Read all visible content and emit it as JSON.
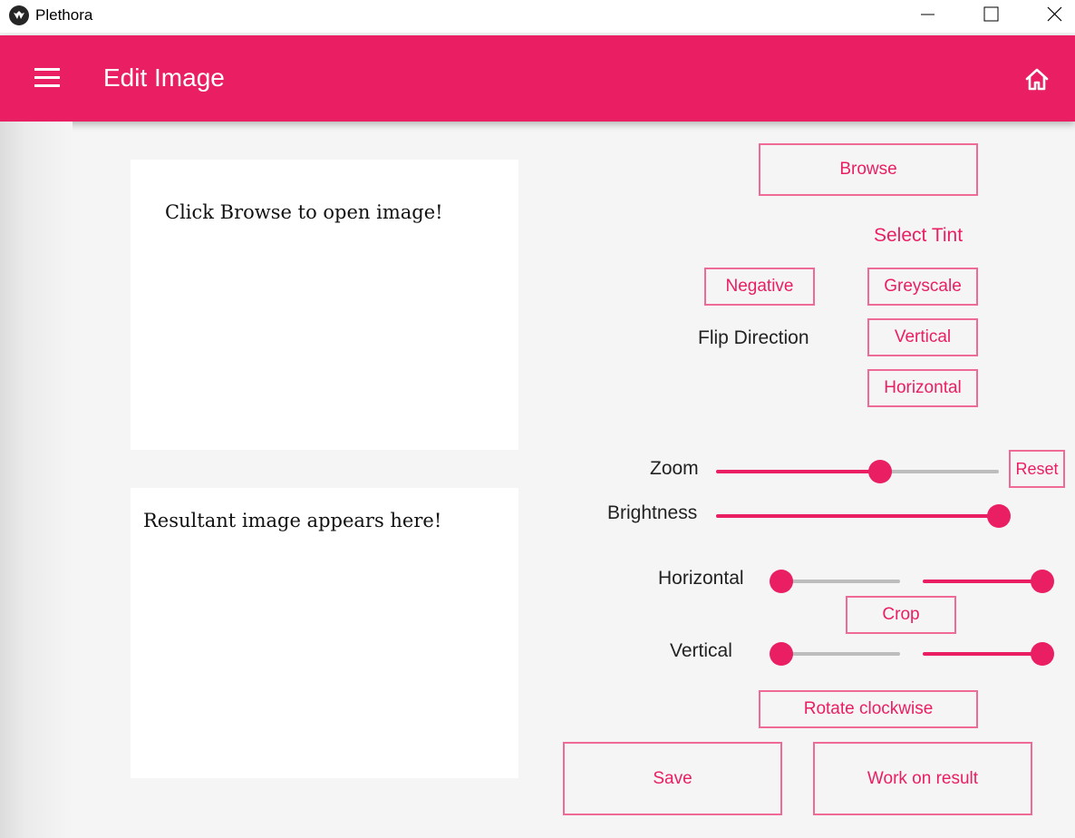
{
  "window": {
    "title": "Plethora"
  },
  "appbar": {
    "title": "Edit Image"
  },
  "panels": {
    "source_text": "Click Browse to open image!",
    "result_text": "Resultant image appears here!"
  },
  "controls": {
    "browse": "Browse",
    "select_tint": "Select Tint",
    "negative": "Negative",
    "greyscale": "Greyscale",
    "flip_direction": "Flip Direction",
    "vertical": "Vertical",
    "horizontal": "Horizontal",
    "zoom": "Zoom",
    "reset": "Reset",
    "brightness": "Brightness",
    "crop_horizontal": "Horizontal",
    "crop": "Crop",
    "crop_vertical": "Vertical",
    "rotate": "Rotate clockwise",
    "save": "Save",
    "work_on_result": "Work on result"
  },
  "sliders": {
    "zoom": 0.58,
    "brightness": 1.0,
    "crop_horizontal": [
      0.0,
      1.0
    ],
    "crop_vertical": [
      0.0,
      1.0
    ]
  },
  "colors": {
    "accent": "#e91e63",
    "button_border": "#ef6a94",
    "track_inactive": "#bdbdbd"
  },
  "icons": {
    "menu": "menu-icon",
    "home": "home-icon",
    "minimize": "minimize-icon",
    "maximize": "maximize-icon",
    "close": "close-icon"
  }
}
